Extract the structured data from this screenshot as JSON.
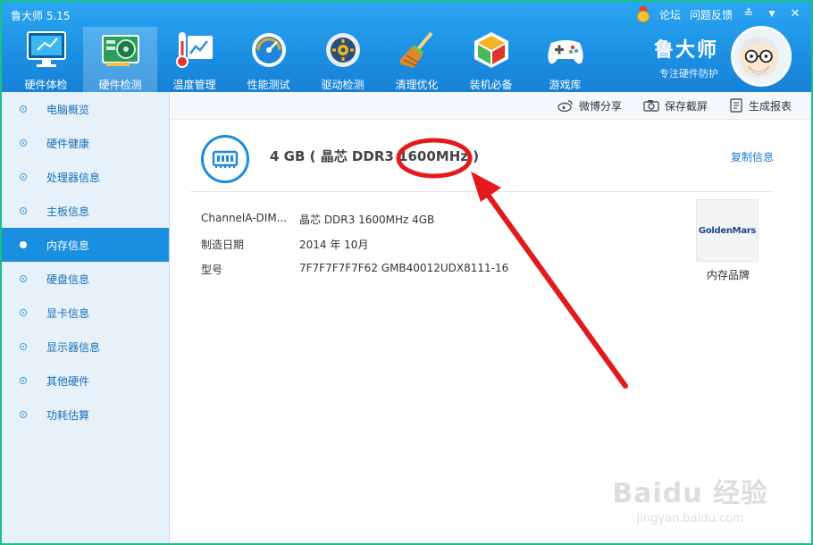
{
  "app": {
    "title": "鲁大师 5.15"
  },
  "top_links": {
    "forum": "论坛",
    "feedback": "问题反馈"
  },
  "window_controls": {
    "skin": "≛",
    "menu": "▼",
    "close": "✕"
  },
  "nav": [
    {
      "label": "硬件体检",
      "icon": "monitor-icon"
    },
    {
      "label": "硬件检测",
      "icon": "graphics-card-icon"
    },
    {
      "label": "温度管理",
      "icon": "thermometer-icon"
    },
    {
      "label": "性能测试",
      "icon": "speedometer-icon"
    },
    {
      "label": "驱动检测",
      "icon": "gear-driver-icon"
    },
    {
      "label": "清理优化",
      "icon": "broom-icon"
    },
    {
      "label": "装机必备",
      "icon": "cube-icon"
    },
    {
      "label": "游戏库",
      "icon": "gamepad-icon"
    }
  ],
  "brand": {
    "name": "鲁大师",
    "slogan": "专注硬件防护"
  },
  "sidebar": [
    {
      "label": "电脑概览"
    },
    {
      "label": "硬件健康"
    },
    {
      "label": "处理器信息"
    },
    {
      "label": "主板信息"
    },
    {
      "label": "内存信息"
    },
    {
      "label": "硬盘信息"
    },
    {
      "label": "显卡信息"
    },
    {
      "label": "显示器信息"
    },
    {
      "label": "其他硬件"
    },
    {
      "label": "功耗估算"
    }
  ],
  "sidebar_active_index": 4,
  "toolbar": {
    "weibo_share": "微博分享",
    "save_screenshot": "保存截屏",
    "generate_report": "生成报表"
  },
  "memory": {
    "title": "4 GB ( 晶芯 DDR3 1600MHz )",
    "copy_label": "复制信息",
    "rows": [
      {
        "label": "ChannelA-DIM...",
        "value": "晶芯 DDR3 1600MHz 4GB"
      },
      {
        "label": "制造日期",
        "value": "2014 年 10月"
      },
      {
        "label": "型号",
        "value": "7F7F7F7F7F62 GMB40012UDX8111-16"
      }
    ],
    "brand_logo_text": "GoldenMars",
    "brand_caption": "内存品牌"
  },
  "watermark": {
    "main": "Baidu 经验",
    "sub": "jingyan.baidu.com"
  },
  "colors": {
    "header": "#1c8fe2",
    "active_nav": "#1a8fe0",
    "annotation": "#e3191b",
    "frame": "#19c08a"
  }
}
